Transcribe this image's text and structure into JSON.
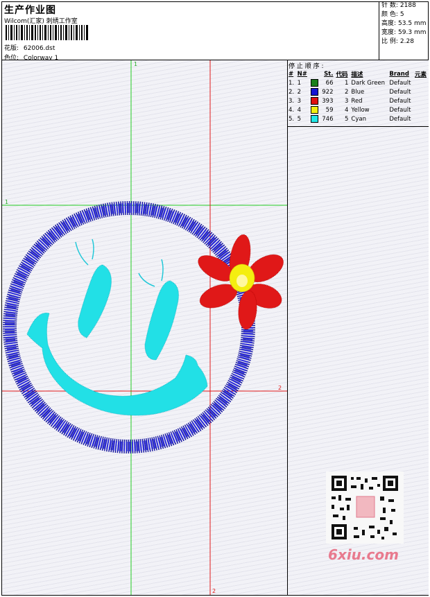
{
  "header": {
    "title": "生产作业图",
    "subtitle": "Wilcom(汇家) 刺绣工作室",
    "pattern_label": "花版:",
    "pattern_value": "62006.dst",
    "colorway_label": "色位:",
    "colorway_value": "Colorway 1"
  },
  "stats": [
    {
      "label": "针 数:",
      "value": "2188"
    },
    {
      "label": "颜 色:",
      "value": "5"
    },
    {
      "label": "高度:",
      "value": "53.5 mm"
    },
    {
      "label": "宽度:",
      "value": "59.3 mm"
    },
    {
      "label": "比 例:",
      "value": "2.28"
    }
  ],
  "stop_sequence": {
    "title": "停 止 顺 序 :",
    "columns": [
      "#",
      "N#",
      "St.",
      "代码",
      "描述",
      "Brand",
      "元素"
    ],
    "rows": [
      {
        "idx": "1.",
        "n": "1",
        "color": "#1a7f1a",
        "st": "66",
        "code": "1",
        "desc": "Dark Green",
        "brand": "Default"
      },
      {
        "idx": "2.",
        "n": "2",
        "color": "#1414d2",
        "st": "922",
        "code": "2",
        "desc": "Blue",
        "brand": "Default"
      },
      {
        "idx": "3.",
        "n": "3",
        "color": "#e01010",
        "st": "393",
        "code": "3",
        "desc": "Red",
        "brand": "Default"
      },
      {
        "idx": "4.",
        "n": "4",
        "color": "#f2ef10",
        "st": "59",
        "code": "4",
        "desc": "Yellow",
        "brand": "Default"
      },
      {
        "idx": "5.",
        "n": "5",
        "color": "#22e6e6",
        "st": "746",
        "code": "5",
        "desc": "Cyan",
        "brand": "Default"
      }
    ]
  },
  "guides": {
    "green_top": "1",
    "green_left": "1",
    "red_right": "2",
    "red_bottom": "2"
  },
  "watermark": "6xiu.com"
}
